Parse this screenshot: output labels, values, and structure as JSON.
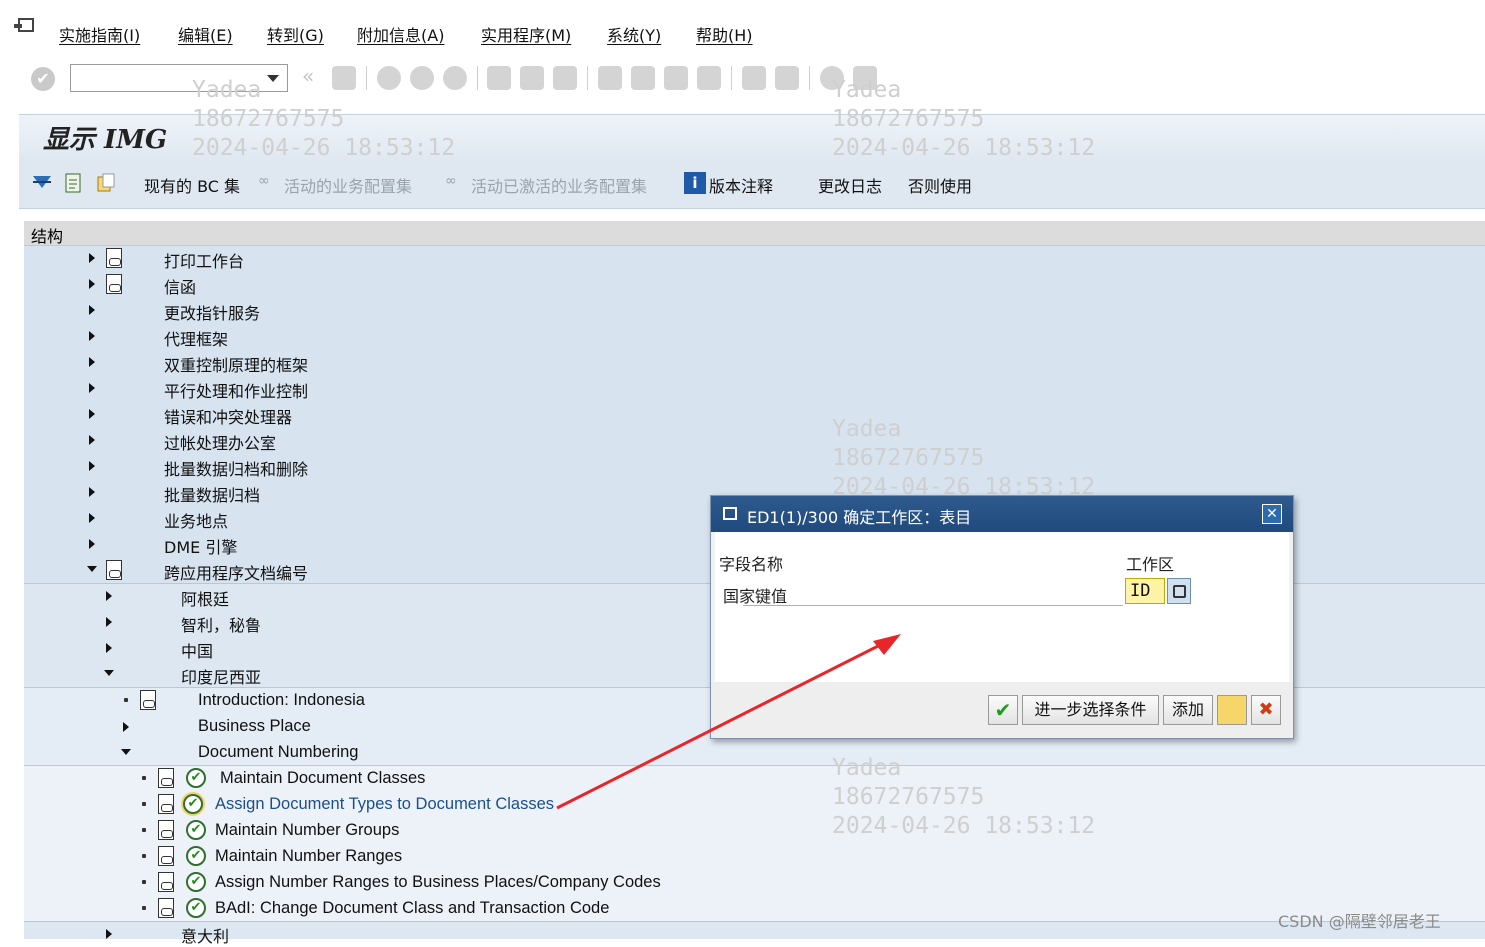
{
  "menubar": {
    "items": [
      "实施指南(I)",
      "编辑(E)",
      "转到(G)",
      "附加信息(A)",
      "实用程序(M)",
      "系统(Y)",
      "帮助(H)"
    ]
  },
  "toolbar": {
    "command_field": "",
    "icons": [
      "enter-icon",
      "save-icon",
      "back-icon",
      "exit-icon",
      "cancel-icon",
      "print-icon",
      "find-icon",
      "find-next-icon",
      "first-page-icon",
      "previous-page-icon",
      "next-page-icon",
      "last-page-icon",
      "new-session-icon",
      "shortcut-icon",
      "help-icon",
      "customize-layout-icon"
    ]
  },
  "page": {
    "title": "显示 IMG"
  },
  "app_toolbar": {
    "bc_sets": "现有的 BC 集",
    "active_bc_sets": "活动的业务配置集",
    "activated_bc_sets": "活动已激活的业务配置集",
    "release_notes": "版本注释",
    "change_log": "更改日志",
    "where_used": "否则使用"
  },
  "tree": {
    "header": "结构",
    "nodes": [
      "打印工作台",
      "信函",
      "更改指针服务",
      "代理框架",
      "双重控制原理的框架",
      "平行处理和作业控制",
      "错误和冲突处理器",
      "过帐处理办公室",
      "批量数据归档和删除",
      "批量数据归档",
      "业务地点",
      "DME 引擎",
      "跨应用程序文档编号",
      "阿根廷",
      "智利，秘鲁",
      "中国",
      "印度尼西亚",
      "Introduction: Indonesia",
      "Business Place",
      "Document Numbering",
      "Maintain Document Classes",
      "Assign Document Types to Document Classes",
      "Maintain Number Groups",
      "Maintain Number Ranges",
      "Assign Number Ranges to Business Places/Company Codes",
      "BAdI: Change Document Class and Transaction Code",
      "意大利"
    ]
  },
  "watermark": {
    "name": "Yadea",
    "phone": "18672767575",
    "datetime": "2024-04-26 18:53:12"
  },
  "dialog": {
    "title": "ED1(1)/300 确定工作区：表目",
    "col_field_name": "字段名称",
    "col_work_area": "工作区",
    "row_label": "国家键值",
    "input_value": "ID",
    "btn_more_criteria": "进一步选择条件",
    "btn_add": "添加",
    "ok_glyph": "✔",
    "cancel_glyph": "✖",
    "close_glyph": "✕"
  },
  "footer_watermark": "CSDN @隔壁邻居老王",
  "colors": {
    "tree_bg": "#d7e3ef",
    "dialog_title_bg": "#1f4a7d",
    "annotation_arrow": "#e8262a",
    "input_highlight": "#fff3a8"
  }
}
